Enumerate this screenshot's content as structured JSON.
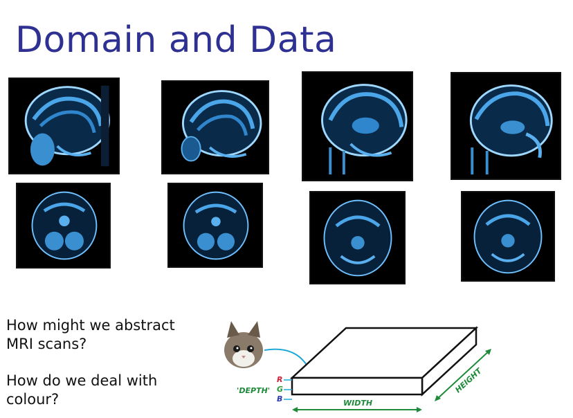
{
  "slide": {
    "title": "Domain and Data",
    "question_1": "How might we abstract MRI scans?",
    "question_2": "How do we deal with colour?"
  },
  "scans": {
    "sagittal_count": 4,
    "axial_count": 4,
    "scan_color": "#4aa6e8",
    "background_color": "#000000"
  },
  "diagram": {
    "channel_r": "R",
    "channel_g": "G",
    "channel_b": "B",
    "depth_label": "'DEPTH'",
    "width_label": "WIDTH",
    "height_label": "HEIGHT",
    "colors": {
      "title": "#2e3192",
      "dimension_green": "#1e8a3a",
      "arrow_cyan": "#1ea8d8",
      "r": "#d0203a",
      "g": "#2a9a3a",
      "b": "#2a3ab0"
    }
  }
}
